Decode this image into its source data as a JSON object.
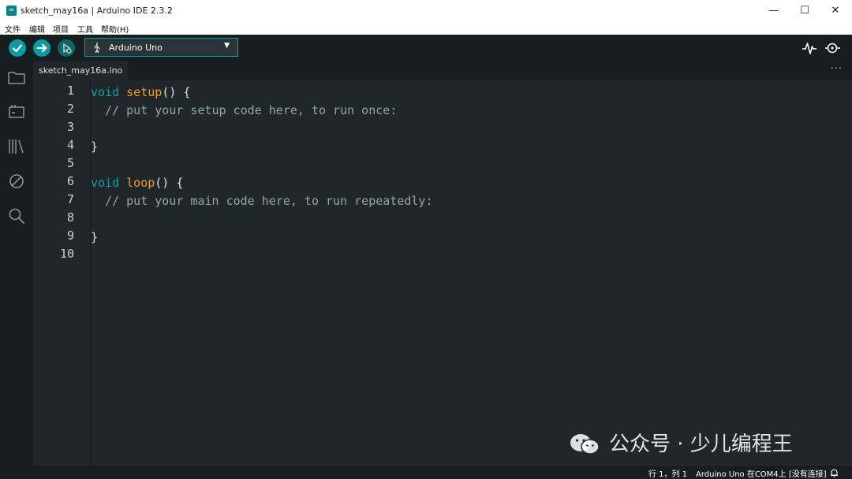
{
  "window": {
    "title": "sketch_may16a | Arduino IDE 2.3.2",
    "app_icon_glyph": "∞",
    "minimize": "—",
    "maximize": "☐",
    "close": "✕"
  },
  "menu": [
    "文件",
    "编辑",
    "项目",
    "工具",
    "帮助(H)"
  ],
  "toolbar": {
    "board": "Arduino Uno",
    "verify_color": "#0a9ca5",
    "accent": "#0ca1a6"
  },
  "sidebar": {
    "items": [
      "folder-icon",
      "board-icon",
      "library-icon",
      "debug-icon",
      "search-icon"
    ]
  },
  "tab": {
    "filename": "sketch_may16a.ino",
    "more": "···"
  },
  "editor": {
    "line_numbers": [
      "1",
      "2",
      "3",
      "4",
      "5",
      "6",
      "7",
      "8",
      "9",
      "10"
    ],
    "lines": [
      [
        {
          "t": "void",
          "c": "kw"
        },
        {
          "t": " ",
          "c": ""
        },
        {
          "t": "setup",
          "c": "fn"
        },
        {
          "t": "() {",
          "c": ""
        }
      ],
      [
        {
          "t": "  // put your setup code here, to run once:",
          "c": "cm"
        }
      ],
      [],
      [
        {
          "t": "}",
          "c": ""
        }
      ],
      [],
      [
        {
          "t": "void",
          "c": "kw"
        },
        {
          "t": " ",
          "c": ""
        },
        {
          "t": "loop",
          "c": "fn"
        },
        {
          "t": "() {",
          "c": ""
        }
      ],
      [
        {
          "t": "  // put your main code here, to run repeatedly:",
          "c": "cm"
        }
      ],
      [],
      [
        {
          "t": "}",
          "c": ""
        }
      ],
      []
    ]
  },
  "watermark": {
    "text": "公众号 · 少儿编程王"
  },
  "status": {
    "position": "行 1，列 1",
    "board_port": "Arduino Uno 在COM4上 [没有连接]"
  }
}
